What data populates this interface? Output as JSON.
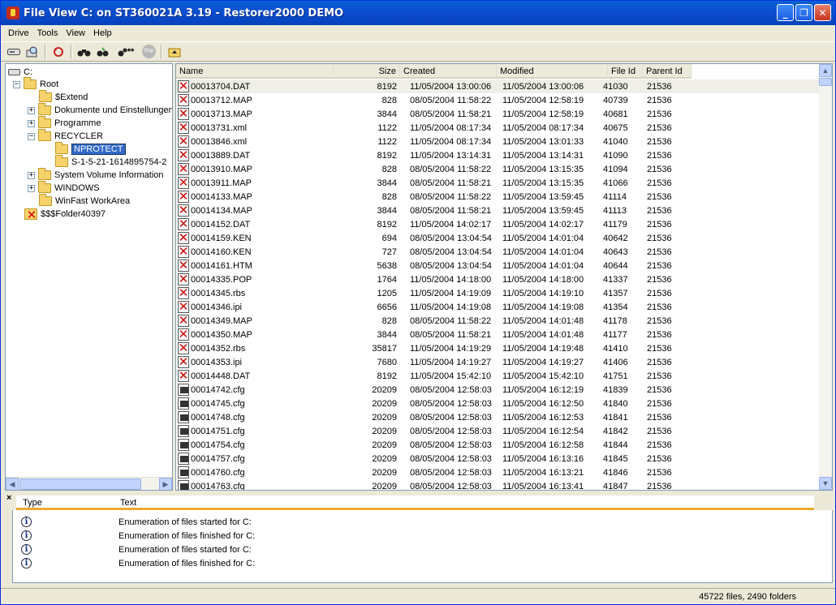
{
  "window": {
    "title": "File View C: on ST360021A 3.19 - Restorer2000 DEMO"
  },
  "menu": [
    "Drive",
    "Tools",
    "View",
    "Help"
  ],
  "toolbar": {
    "icons": [
      "drive-icon",
      "search-icon",
      "recover-icon",
      "find-icon",
      "find-next-icon",
      "find-mask-icon",
      "stop-icon",
      "up-folder-icon"
    ],
    "find_mask_label": "**",
    "stop_label": "Stop"
  },
  "tree": {
    "drive": "C:",
    "root": "Root",
    "items": [
      "$Extend",
      "Dokumente und Einstellungen",
      "Programme",
      "RECYCLER",
      "NPROTECT",
      "S-1-5-21-1614895754-2",
      "System Volume Information",
      "WINDOWS",
      "WinFast WorkArea",
      "$$$Folder40397"
    ],
    "expanders": {
      "root": "−",
      "dokumente": "+",
      "programme": "+",
      "recycler": "−",
      "system": "+",
      "windows": "+"
    }
  },
  "columns": [
    "Name",
    "Size",
    "Created",
    "Modified",
    "File Id",
    "Parent Id"
  ],
  "files": [
    {
      "name": "00013704.DAT",
      "size": "8192",
      "created": "11/05/2004 13:00:06",
      "modified": "11/05/2004 13:00:06",
      "fileid": "41030",
      "parent": "21536",
      "type": "deleted"
    },
    {
      "name": "00013712.MAP",
      "size": "828",
      "created": "08/05/2004 11:58:22",
      "modified": "11/05/2004 12:58:19",
      "fileid": "40739",
      "parent": "21536",
      "type": "deleted"
    },
    {
      "name": "00013713.MAP",
      "size": "3844",
      "created": "08/05/2004 11:58:21",
      "modified": "11/05/2004 12:58:19",
      "fileid": "40681",
      "parent": "21536",
      "type": "deleted"
    },
    {
      "name": "00013731.xml",
      "size": "1122",
      "created": "11/05/2004 08:17:34",
      "modified": "11/05/2004 08:17:34",
      "fileid": "40675",
      "parent": "21536",
      "type": "deleted"
    },
    {
      "name": "00013846.xml",
      "size": "1122",
      "created": "11/05/2004 08:17:34",
      "modified": "11/05/2004 13:01:33",
      "fileid": "41040",
      "parent": "21536",
      "type": "deleted"
    },
    {
      "name": "00013889.DAT",
      "size": "8192",
      "created": "11/05/2004 13:14:31",
      "modified": "11/05/2004 13:14:31",
      "fileid": "41090",
      "parent": "21536",
      "type": "deleted"
    },
    {
      "name": "00013910.MAP",
      "size": "828",
      "created": "08/05/2004 11:58:22",
      "modified": "11/05/2004 13:15:35",
      "fileid": "41094",
      "parent": "21536",
      "type": "deleted"
    },
    {
      "name": "00013911.MAP",
      "size": "3844",
      "created": "08/05/2004 11:58:21",
      "modified": "11/05/2004 13:15:35",
      "fileid": "41066",
      "parent": "21536",
      "type": "deleted"
    },
    {
      "name": "00014133.MAP",
      "size": "828",
      "created": "08/05/2004 11:58:22",
      "modified": "11/05/2004 13:59:45",
      "fileid": "41114",
      "parent": "21536",
      "type": "deleted"
    },
    {
      "name": "00014134.MAP",
      "size": "3844",
      "created": "08/05/2004 11:58:21",
      "modified": "11/05/2004 13:59:45",
      "fileid": "41113",
      "parent": "21536",
      "type": "deleted"
    },
    {
      "name": "00014152.DAT",
      "size": "8192",
      "created": "11/05/2004 14:02:17",
      "modified": "11/05/2004 14:02:17",
      "fileid": "41179",
      "parent": "21536",
      "type": "deleted"
    },
    {
      "name": "00014159.KEN",
      "size": "694",
      "created": "08/05/2004 13:04:54",
      "modified": "11/05/2004 14:01:04",
      "fileid": "40642",
      "parent": "21536",
      "type": "deleted"
    },
    {
      "name": "00014160.KEN",
      "size": "727",
      "created": "08/05/2004 13:04:54",
      "modified": "11/05/2004 14:01:04",
      "fileid": "40643",
      "parent": "21536",
      "type": "deleted"
    },
    {
      "name": "00014161.HTM",
      "size": "5638",
      "created": "08/05/2004 13:04:54",
      "modified": "11/05/2004 14:01:04",
      "fileid": "40644",
      "parent": "21536",
      "type": "deleted"
    },
    {
      "name": "00014335.POP",
      "size": "1764",
      "created": "11/05/2004 14:18:00",
      "modified": "11/05/2004 14:18:00",
      "fileid": "41337",
      "parent": "21536",
      "type": "deleted"
    },
    {
      "name": "00014345.rbs",
      "size": "1205",
      "created": "11/05/2004 14:19:09",
      "modified": "11/05/2004 14:19:10",
      "fileid": "41357",
      "parent": "21536",
      "type": "deleted"
    },
    {
      "name": "00014346.ipi",
      "size": "6656",
      "created": "11/05/2004 14:19:08",
      "modified": "11/05/2004 14:19:08",
      "fileid": "41354",
      "parent": "21536",
      "type": "deleted"
    },
    {
      "name": "00014349.MAP",
      "size": "828",
      "created": "08/05/2004 11:58:22",
      "modified": "11/05/2004 14:01:48",
      "fileid": "41178",
      "parent": "21536",
      "type": "deleted"
    },
    {
      "name": "00014350.MAP",
      "size": "3844",
      "created": "08/05/2004 11:58:21",
      "modified": "11/05/2004 14:01:48",
      "fileid": "41177",
      "parent": "21536",
      "type": "deleted"
    },
    {
      "name": "00014352.rbs",
      "size": "35817",
      "created": "11/05/2004 14:19:29",
      "modified": "11/05/2004 14:19:48",
      "fileid": "41410",
      "parent": "21536",
      "type": "deleted"
    },
    {
      "name": "00014353.ipi",
      "size": "7680",
      "created": "11/05/2004 14:19:27",
      "modified": "11/05/2004 14:19:27",
      "fileid": "41406",
      "parent": "21536",
      "type": "deleted"
    },
    {
      "name": "00014448.DAT",
      "size": "8192",
      "created": "11/05/2004 15:42:10",
      "modified": "11/05/2004 15:42:10",
      "fileid": "41751",
      "parent": "21536",
      "type": "deleted"
    },
    {
      "name": "00014742.cfg",
      "size": "20209",
      "created": "08/05/2004 12:58:03",
      "modified": "11/05/2004 16:12:19",
      "fileid": "41839",
      "parent": "21536",
      "type": "cfg"
    },
    {
      "name": "00014745.cfg",
      "size": "20209",
      "created": "08/05/2004 12:58:03",
      "modified": "11/05/2004 16:12:50",
      "fileid": "41840",
      "parent": "21536",
      "type": "cfg"
    },
    {
      "name": "00014748.cfg",
      "size": "20209",
      "created": "08/05/2004 12:58:03",
      "modified": "11/05/2004 16:12:53",
      "fileid": "41841",
      "parent": "21536",
      "type": "cfg"
    },
    {
      "name": "00014751.cfg",
      "size": "20209",
      "created": "08/05/2004 12:58:03",
      "modified": "11/05/2004 16:12:54",
      "fileid": "41842",
      "parent": "21536",
      "type": "cfg"
    },
    {
      "name": "00014754.cfg",
      "size": "20209",
      "created": "08/05/2004 12:58:03",
      "modified": "11/05/2004 16:12:58",
      "fileid": "41844",
      "parent": "21536",
      "type": "cfg"
    },
    {
      "name": "00014757.cfg",
      "size": "20209",
      "created": "08/05/2004 12:58:03",
      "modified": "11/05/2004 16:13:16",
      "fileid": "41845",
      "parent": "21536",
      "type": "cfg"
    },
    {
      "name": "00014760.cfg",
      "size": "20209",
      "created": "08/05/2004 12:58:03",
      "modified": "11/05/2004 16:13:21",
      "fileid": "41846",
      "parent": "21536",
      "type": "cfg"
    },
    {
      "name": "00014763.cfg",
      "size": "20209",
      "created": "08/05/2004 12:58:03",
      "modified": "11/05/2004 16:13:41",
      "fileid": "41847",
      "parent": "21536",
      "type": "cfg"
    }
  ],
  "log": {
    "close_label": "×",
    "columns": [
      "Type",
      "Text"
    ],
    "rows": [
      {
        "icon": "info-icon",
        "text": "Enumeration of files started for C:"
      },
      {
        "icon": "info-icon",
        "text": "Enumeration of files finished for C:"
      },
      {
        "icon": "info-icon",
        "text": "Enumeration of files started for C:"
      },
      {
        "icon": "info-icon",
        "text": "Enumeration of files finished for C:"
      }
    ]
  },
  "status": {
    "text": "45722 files, 2490 folders"
  },
  "colors": {
    "titlebar": "#0a5fd6",
    "selection": "#316ac5",
    "accent": "#f0a830"
  }
}
